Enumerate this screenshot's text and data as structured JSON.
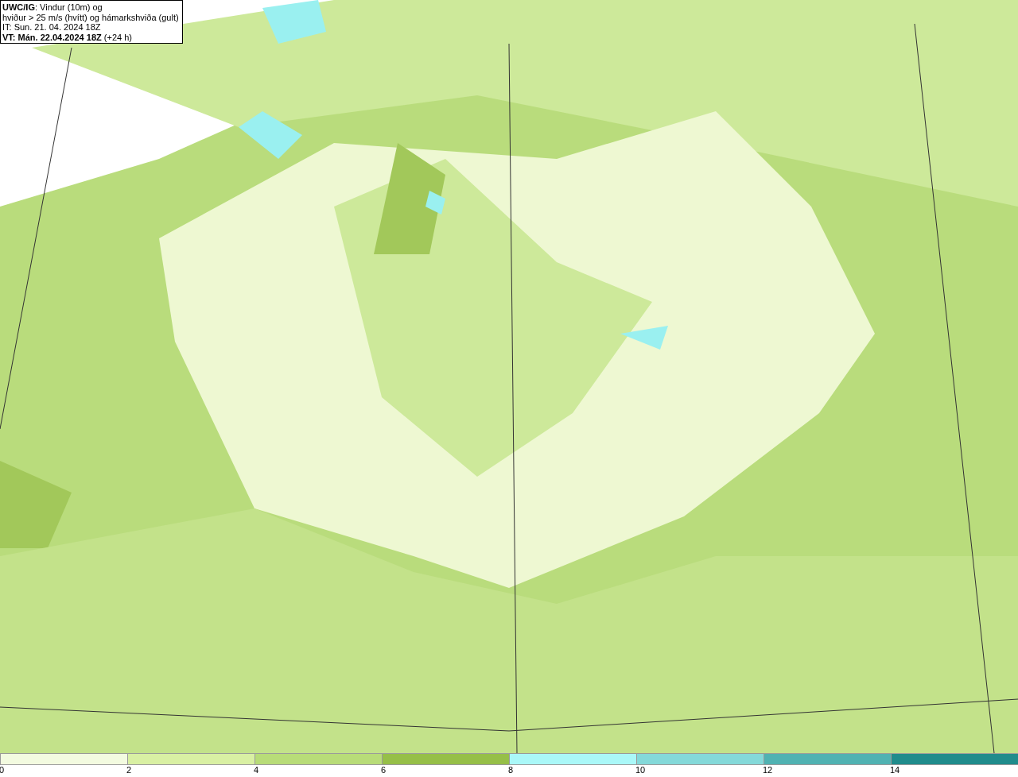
{
  "info_box": {
    "lines": [
      "**UWC/IG**: Vindur (10m) og",
      "hviður > 25 m/s (hvítt) og hámarkshviða (gult)",
      "IT: Sun. 21. 04. 2024 18Z",
      "**VT: Mán. 22.04.2024 18Z** (+24 h)"
    ]
  },
  "legend": [
    {
      "label": "0",
      "color": "#f3fbe0"
    },
    {
      "label": "2",
      "color": "#d9f0a3"
    },
    {
      "label": "4",
      "color": "#b8dc78"
    },
    {
      "label": "6",
      "color": "#96bf48"
    },
    {
      "label": "8",
      "color": "#aaf8f8"
    },
    {
      "label": "10",
      "color": "#84d9d9"
    },
    {
      "label": "12",
      "color": "#50b2b2"
    },
    {
      "label": "14",
      "color": "#208c8c"
    }
  ]
}
